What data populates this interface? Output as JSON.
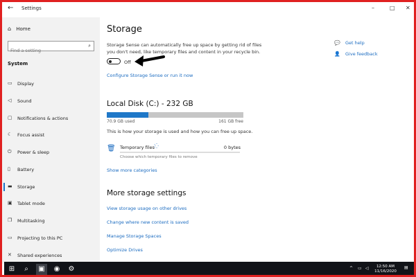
{
  "window": {
    "title": "Settings",
    "back_icon": "back-arrow-icon"
  },
  "sidebar": {
    "home": "Home",
    "search_placeholder": "Find a setting",
    "section": "System",
    "items": [
      {
        "label": "Display",
        "icon": "monitor-icon"
      },
      {
        "label": "Sound",
        "icon": "speaker-icon"
      },
      {
        "label": "Notifications & actions",
        "icon": "notification-icon"
      },
      {
        "label": "Focus assist",
        "icon": "moon-icon"
      },
      {
        "label": "Power & sleep",
        "icon": "power-icon"
      },
      {
        "label": "Battery",
        "icon": "battery-icon"
      },
      {
        "label": "Storage",
        "icon": "storage-icon",
        "active": true
      },
      {
        "label": "Tablet mode",
        "icon": "tablet-icon"
      },
      {
        "label": "Multitasking",
        "icon": "multitask-icon"
      },
      {
        "label": "Projecting to this PC",
        "icon": "project-icon"
      },
      {
        "label": "Shared experiences",
        "icon": "share-icon"
      }
    ]
  },
  "main": {
    "title": "Storage",
    "desc_line1": "Storage Sense can automatically free up space by getting rid of files",
    "desc_line2": "you don't need, like temporary files and content in your recycle bin.",
    "toggle_label": "Off",
    "toggle_on": false,
    "configure_link": "Configure Storage Sense or run it now",
    "disk_title": "Local Disk (C:) - 232 GB",
    "used": "70.9 GB used",
    "free": "161 GB free",
    "used_fraction": 0.305,
    "disk_desc": "This is how your storage is used and how you can free up space.",
    "temp_label": "Temporary files",
    "temp_size": "0 bytes",
    "temp_sub": "Choose which temporary files to remove",
    "show_more": "Show more categories",
    "more_title": "More storage settings",
    "more_links": [
      "View storage usage on other drives",
      "Change where new content is saved",
      "Manage Storage Spaces",
      "Optimize Drives"
    ],
    "help": "Get help",
    "feedback": "Give feedback"
  },
  "taskbar": {
    "time": "12:50 AM",
    "date": "11/16/2020"
  },
  "colors": {
    "accent": "#1a6bc0",
    "frame": "#e02020"
  }
}
